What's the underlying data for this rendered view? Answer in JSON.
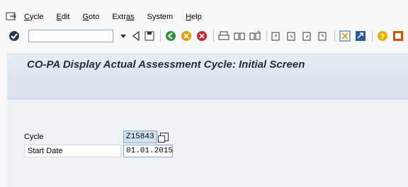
{
  "menu": {
    "items": [
      {
        "label": "Cycle",
        "mnemonic": "C",
        "rest": "ycle"
      },
      {
        "label": "Edit",
        "mnemonic": "E",
        "rest": "dit"
      },
      {
        "label": "Goto",
        "mnemonic": "G",
        "rest": "oto"
      },
      {
        "label": "Extras",
        "mnemonic": "Extr",
        "rest": "as"
      },
      {
        "label": "System",
        "mnemonic": "Sy",
        "rest": "stem"
      },
      {
        "label": "Help",
        "mnemonic": "H",
        "rest": "elp"
      }
    ]
  },
  "toolbar": {
    "command_field_value": ""
  },
  "screen": {
    "title": "CO-PA Display Actual Assessment Cycle: Initial Screen"
  },
  "form": {
    "cycle_label": "Cycle",
    "cycle_value": "Z15843",
    "start_date_label": "Start Date",
    "start_date_value": "01.01.2015"
  }
}
